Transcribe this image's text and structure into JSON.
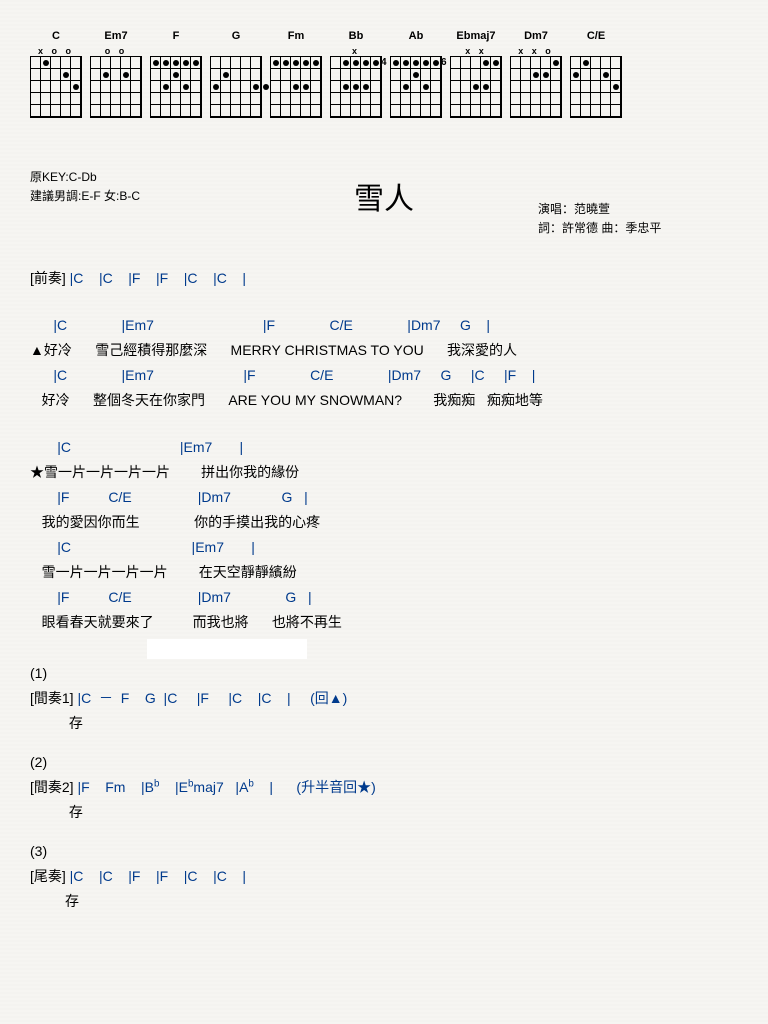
{
  "chord_diagrams": [
    {
      "name": "C",
      "top": "x   o o"
    },
    {
      "name": "Em7",
      "top": "o     o"
    },
    {
      "name": "F",
      "top": ""
    },
    {
      "name": "G",
      "top": ""
    },
    {
      "name": "Fm",
      "top": ""
    },
    {
      "name": "Bb",
      "top": "x"
    },
    {
      "name": "Ab",
      "top": "",
      "fret": "4"
    },
    {
      "name": "Ebmaj7",
      "top": "x x",
      "fret": "6"
    },
    {
      "name": "Dm7",
      "top": "x x   o"
    },
    {
      "name": "C/E",
      "top": ""
    }
  ],
  "meta": {
    "original_key": "原KEY:C-Db",
    "suggest": "建議男調:E-F 女:B-C",
    "title": "雪人",
    "singer": "演唱：范曉萱",
    "credits": "詞：許常德  曲：季忠平"
  },
  "intro": {
    "label": "[前奏]",
    "chords": " |C    |C    |F    |F    |C    |C    |"
  },
  "verse": {
    "l1_chords": "      |C              |Em7                            |F              C/E              |Dm7     G    |",
    "l1_lyric": "▲好冷      雪己經積得那麼深      MERRY CHRISTMAS TO YOU      我深愛的人",
    "l2_chords": "      |C              |Em7                       |F              C/E              |Dm7     G     |C     |F    |",
    "l2_lyric": "   好冷      整個冬天在你家門      ARE YOU MY SNOWMAN?        我痴痴   痴痴地等"
  },
  "chorus": {
    "l1_chords": "       |C                            |Em7       |",
    "l1_lyric": "★雪一片一片一片一片        拼出你我的緣份",
    "l2_chords": "       |F          C/E                 |Dm7             G   |",
    "l2_lyric": "   我的愛因你而生              你的手摸出我的心疼",
    "l3_chords": "       |C                               |Em7       |",
    "l3_lyric": "   雪一片一片一片一片        在天空靜靜繽紛",
    "l4_chords": "       |F          C/E                 |Dm7              G   |",
    "l4_lyric": "   眼看春天就要來了          而我也將      也將不再生"
  },
  "repeats": {
    "r1_num": "(1)",
    "r1_label": "[間奏1]",
    "r1_chords": " |C  －  F    G  |C     |F     |C    |C    |     (回▲)",
    "r1_cun": "          存",
    "r2_num": "(2)",
    "r2_label": "[間奏2]",
    "r2_chords_html": " |F    Fm    |B<sup>b</sup>    |E<sup>b</sup>maj7   |A<sup>b</sup>    |      (升半音回★)",
    "r2_cun": "          存",
    "r3_num": "(3)",
    "r3_label": "[尾奏]",
    "r3_chords": " |C    |C    |F    |F    |C    |C    |",
    "r3_cun": "         存"
  }
}
